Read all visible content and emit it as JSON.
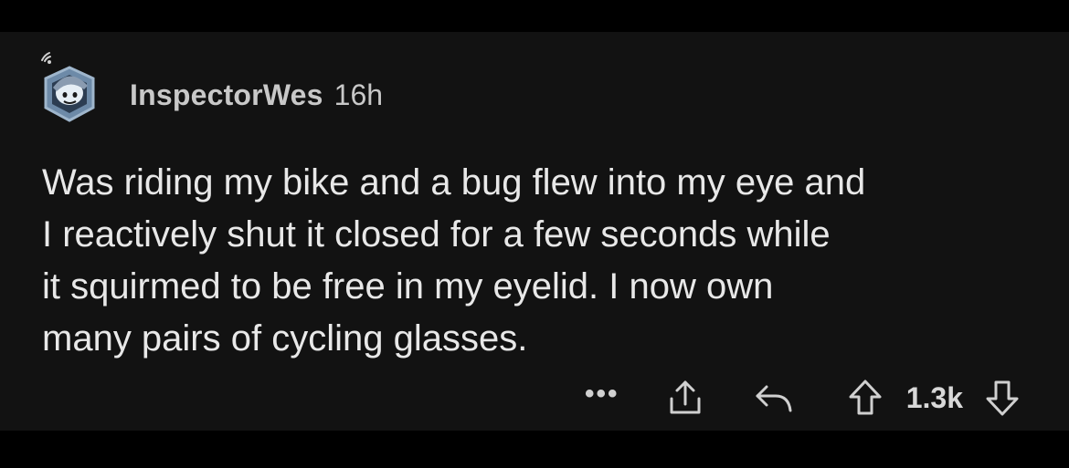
{
  "comment": {
    "username": "InspectorWes",
    "timestamp": "16h",
    "body": "Was riding my bike and a bug flew into my eye and\nI reactively shut it closed for a few seconds while\nit squirmed to be free in my eyelid. I now own\nmany pairs of cycling glasses.",
    "actions": {
      "more_label": "•••",
      "score": "1.3k"
    }
  },
  "icons": {
    "avatar": "snoo-avatar-icon",
    "online": "online-signal-icon",
    "more": "more-options-icon",
    "share": "share-icon",
    "reply": "reply-icon",
    "upvote": "upvote-arrow-icon",
    "downvote": "downvote-arrow-icon"
  },
  "colors": {
    "page_background": "#000000",
    "card_background": "#121212",
    "body_text": "#e8e8e8",
    "meta_text": "#c8c8c8"
  }
}
